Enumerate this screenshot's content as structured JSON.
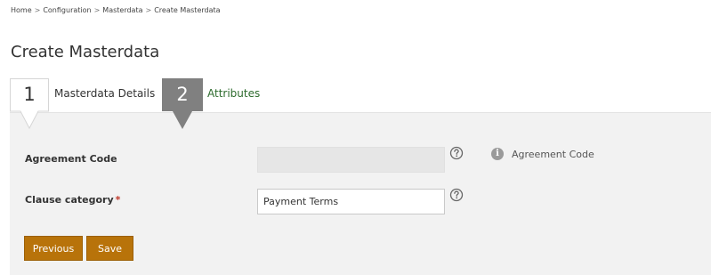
{
  "breadcrumb": {
    "items": [
      "Home",
      "Configuration",
      "Masterdata",
      "Create Masterdata"
    ],
    "separator": ">"
  },
  "page": {
    "title": "Create Masterdata"
  },
  "steps": [
    {
      "number": "1",
      "label": "Masterdata Details",
      "state": "active"
    },
    {
      "number": "2",
      "label": "Attributes",
      "state": "link"
    }
  ],
  "form": {
    "agreement_code": {
      "label": "Agreement Code",
      "value": "",
      "disabled": true,
      "help_icon": "question-circle-icon",
      "info_icon": "info-circle-icon",
      "info_text": "Agreement Code"
    },
    "clause_category": {
      "label": "Clause category",
      "required_marker": "*",
      "value": "Payment Terms",
      "help_icon": "question-circle-icon"
    }
  },
  "buttons": {
    "previous_label": "Previous",
    "save_label": "Save"
  },
  "colors": {
    "button_bg": "#b8730a",
    "active_step_bg": "#808080",
    "link_green": "#2d6b2d",
    "panel_bg": "#f2f2f2",
    "required": "#c0392b"
  }
}
